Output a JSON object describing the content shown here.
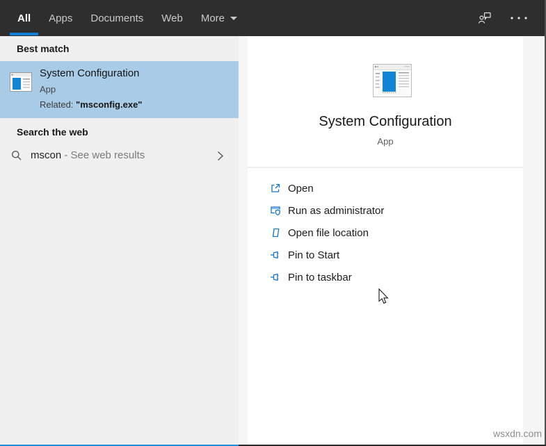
{
  "colors": {
    "accent": "#0f7fd7",
    "highlight": "#a8cbe8",
    "topbar_bg": "#2e2e2e",
    "action_icon_blue": "#1476d1"
  },
  "topbar": {
    "tabs": [
      {
        "label": "All",
        "active": true
      },
      {
        "label": "Apps",
        "active": false
      },
      {
        "label": "Documents",
        "active": false
      },
      {
        "label": "Web",
        "active": false
      },
      {
        "label": "More",
        "active": false
      }
    ],
    "icons": {
      "feedback": "feedback-icon",
      "ellipsis": "ellipsis-icon"
    }
  },
  "left_panel": {
    "sections": [
      {
        "header": "Best match"
      },
      {
        "header": "Search the web"
      }
    ],
    "best_match": {
      "icon": "msconfig-app-icon",
      "title": "System Configuration",
      "type": "App",
      "related_prefix": "Related: ",
      "related_value": "\"msconfig.exe\""
    },
    "web_search": {
      "icon": "search-icon",
      "query": "mscon",
      "suffix": " - See web results",
      "chevron": "chevron-right-icon"
    }
  },
  "right_panel": {
    "icon": "msconfig-app-icon",
    "title": "System Configuration",
    "subtitle": "App",
    "actions": [
      {
        "label": "Open",
        "icon": "open-icon"
      },
      {
        "label": "Run as administrator",
        "icon": "run-as-admin-icon"
      },
      {
        "label": "Open file location",
        "icon": "open-file-location-icon"
      },
      {
        "label": "Pin to Start",
        "icon": "pin-icon"
      },
      {
        "label": "Pin to taskbar",
        "icon": "pin-icon"
      }
    ]
  },
  "watermark": "wsxdn.com"
}
